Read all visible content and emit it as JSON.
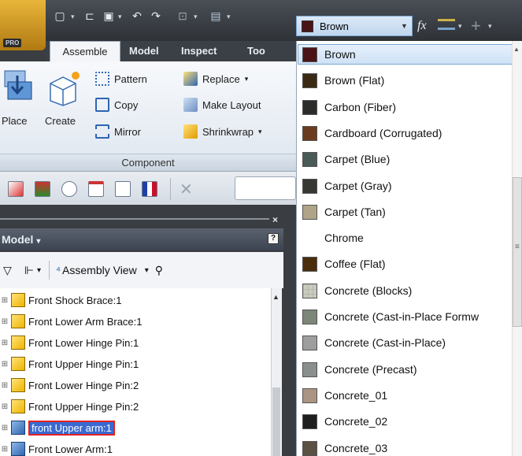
{
  "app": {
    "edition_badge": "PRO"
  },
  "toolbar": {
    "material_selector": {
      "value": "Brown",
      "swatch": "#4a1416"
    },
    "function_label": "fx"
  },
  "ribbon": {
    "tabs": [
      {
        "label": "Assemble"
      },
      {
        "label": "Model"
      },
      {
        "label": "Inspect"
      },
      {
        "label": "Too"
      }
    ],
    "buttons": {
      "place": "Place",
      "create": "Create",
      "pattern": "Pattern",
      "replace": "Replace",
      "copy": "Copy",
      "make_layout": "Make Layout",
      "mirror": "Mirror",
      "shrinkwrap": "Shrinkwrap"
    },
    "panel_title": "Component"
  },
  "browser": {
    "title": "Model",
    "view_label": "Assembly View",
    "items": [
      {
        "label": "Front Shock Brace:1",
        "type": "part"
      },
      {
        "label": "Front Lower Arm Brace:1",
        "type": "part"
      },
      {
        "label": "Front Lower Hinge Pin:1",
        "type": "part"
      },
      {
        "label": "Front Upper Hinge Pin:1",
        "type": "part"
      },
      {
        "label": "Front Lower Hinge Pin:2",
        "type": "part"
      },
      {
        "label": "Front Upper Hinge Pin:2",
        "type": "part"
      },
      {
        "label": "front Upper arm:1",
        "type": "assembly",
        "editing": true
      },
      {
        "label": "Front Lower Arm:1",
        "type": "assembly"
      }
    ]
  },
  "materials": {
    "selected_index": 0,
    "items": [
      {
        "label": "Brown",
        "color": "#4a1416"
      },
      {
        "label": "Brown (Flat)",
        "color": "#3a2a14"
      },
      {
        "label": "Carbon (Fiber)",
        "color": "#2c2c2a"
      },
      {
        "label": "Cardboard (Corrugated)",
        "color": "#6b3b1f"
      },
      {
        "label": "Carpet (Blue)",
        "color": "#4a5a57"
      },
      {
        "label": "Carpet (Gray)",
        "color": "#383833"
      },
      {
        "label": "Carpet (Tan)",
        "color": "#b0a488"
      },
      {
        "label": "Chrome",
        "color": ""
      },
      {
        "label": "Coffee (Flat)",
        "color": "#4a2e0c"
      },
      {
        "label": "Concrete (Blocks)",
        "color": "#c9cbbe"
      },
      {
        "label": "Concrete (Cast-in-Place Formw",
        "color": "#7c8679"
      },
      {
        "label": "Concrete (Cast-in-Place)",
        "color": "#9e9e9e"
      },
      {
        "label": "Concrete (Precast)",
        "color": "#8a8e8c"
      },
      {
        "label": "Concrete_01",
        "color": "#a99483"
      },
      {
        "label": "Concrete_02",
        "color": "#1e1e1e"
      },
      {
        "label": "Concrete_03",
        "color": "#5a5043"
      }
    ]
  }
}
